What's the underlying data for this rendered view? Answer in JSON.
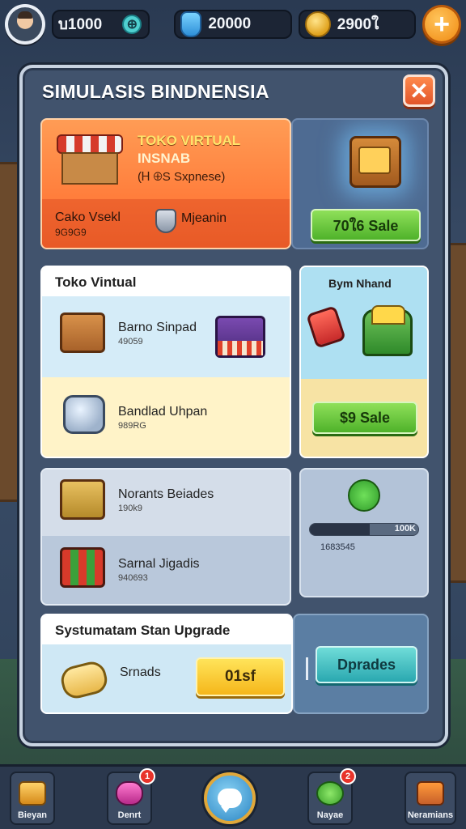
{
  "topbar": {
    "currency1": "บ1000",
    "gems": "20000",
    "gold": "2900ใ"
  },
  "panel": {
    "title": "SIMULASIS BINDNENSIA"
  },
  "featured": {
    "title": "TOKO VIRTUAL",
    "subtitle": "INSNAB",
    "note": "(Ꮋ ⊕S Sxpnese)",
    "bottom_label": "Cako Vsekl",
    "bottom_sub": "9G9G9",
    "mid_label": "Mjeanin",
    "sale_button": "70ใ6 Sale"
  },
  "toko": {
    "title": "Toko Vintual",
    "item1_name": "Barno Sinpad",
    "item1_sub": "49059",
    "item2_name": "Bandlad Uhpan",
    "item2_sub": "989RG"
  },
  "side_offer": {
    "title": "Bym Nhand",
    "sale_button": "$9 Sale"
  },
  "items": {
    "item3_name": "Norants Beiades",
    "item3_sub": "190k9",
    "item4_name": "Sarnal Jigadis",
    "item4_sub": "940693"
  },
  "progress": {
    "label": "100K",
    "sub": "1683545",
    "fill": 0.55
  },
  "upgrade": {
    "title": "Systumatam Stan Upgrade",
    "item_name": "Srnads",
    "price_button": "01sf",
    "upgrade_button": "Dprades"
  },
  "bottomnav": {
    "items": [
      {
        "label": "Bieyan",
        "badge": ""
      },
      {
        "label": "Denrt",
        "badge": "1"
      },
      {
        "label": "Nayae",
        "badge": "2"
      },
      {
        "label": "Neramians",
        "badge": ""
      }
    ]
  },
  "colors": {
    "accent_orange": "#ff7e3c",
    "accent_green": "#4fb22a",
    "panel_bg": "#41536d"
  }
}
